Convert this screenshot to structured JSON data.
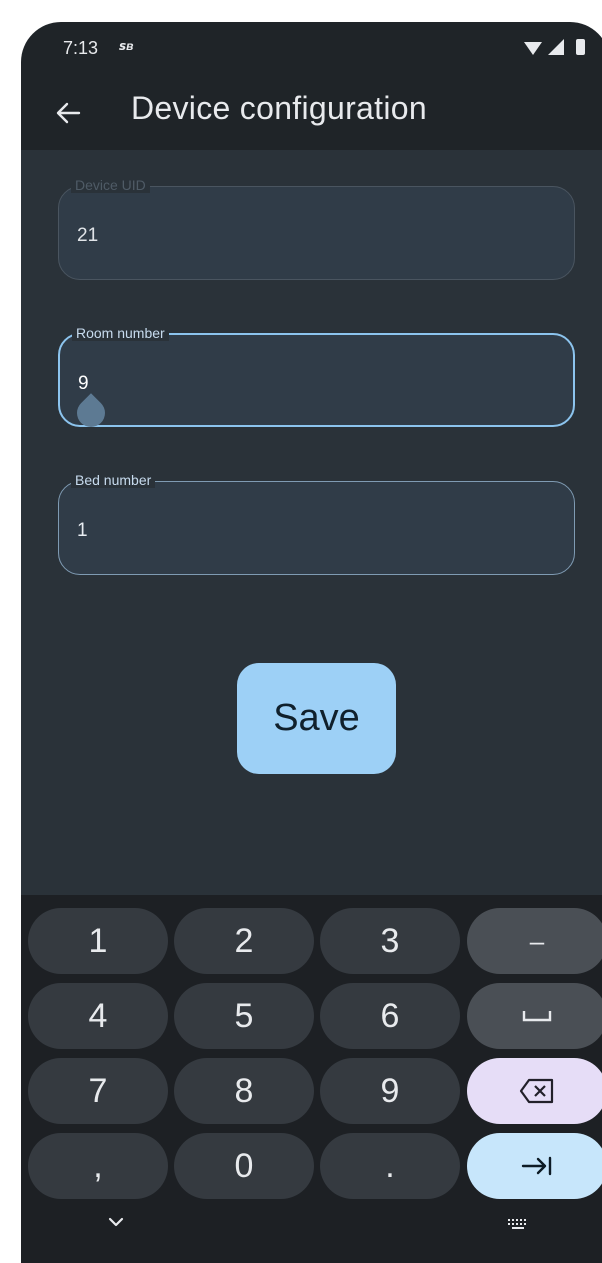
{
  "status_bar": {
    "time": "7:13",
    "app_indicator": "SB",
    "icons": [
      "wifi-icon",
      "signal-icon",
      "battery-icon"
    ]
  },
  "app_bar": {
    "back_icon": "arrow-left-icon",
    "title": "Device configuration"
  },
  "form": {
    "device_uid": {
      "label": "Device UID",
      "value": "21",
      "enabled": false
    },
    "room_number": {
      "label": "Room number",
      "value": "9",
      "focused": true
    },
    "bed_number": {
      "label": "Bed number",
      "value": "1"
    }
  },
  "save_button": {
    "label": "Save"
  },
  "keyboard": {
    "rows": [
      [
        "1",
        "2",
        "3",
        "–"
      ],
      [
        "4",
        "5",
        "6",
        "␣"
      ],
      [
        "7",
        "8",
        "9",
        "⌫"
      ],
      [
        ",",
        "0",
        ".",
        "→|"
      ]
    ],
    "labels": {
      "dash": "–",
      "comma": ",",
      "period": "."
    },
    "bottom_icons": [
      "chevron-down-icon",
      "keyboard-icon"
    ]
  },
  "colors": {
    "background": "#1f2428",
    "content": "#2a3239",
    "accent": "#9dd0f6",
    "backspace_key": "#e6ddf7",
    "tab_key": "#c7e6fb"
  }
}
